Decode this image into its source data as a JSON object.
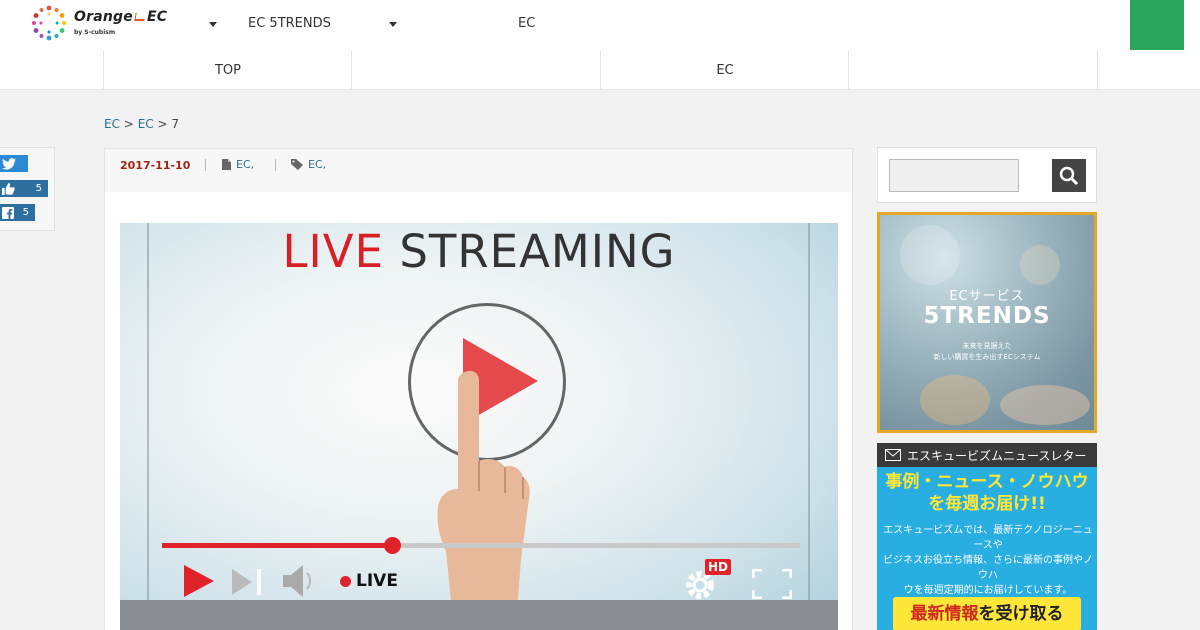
{
  "header": {
    "logo": {
      "name": "Orange",
      "suffix": "EC",
      "sub": "by S-cubism"
    },
    "links": [
      "EC 5TRENDS",
      "EC"
    ],
    "cta_color": "#2aa65a"
  },
  "nav": {
    "items": [
      "TOP",
      "",
      "EC",
      ""
    ]
  },
  "breadcrumb": {
    "items": [
      "EC",
      "EC"
    ],
    "current": "7",
    "separator": ">"
  },
  "share": {
    "twitter_icon": "twitter-bird-icon",
    "like_count": "5",
    "facebook_count": "5"
  },
  "article": {
    "date": "2017-11-10",
    "category": "EC,",
    "tag": "EC,",
    "hero": {
      "title_live": "LIVE",
      "title_rest": " STREAMING",
      "live_label": "LIVE",
      "hd_label": "HD",
      "progress": 0.36,
      "accent": "#e0232b"
    }
  },
  "sidebar": {
    "search": {
      "placeholder": ""
    },
    "banner": {
      "line1": "ECサービス",
      "line2": "5TRENDS",
      "line3": "未来を見据えた\n新しい購買を生み出すECシステム"
    },
    "newsletter": {
      "heading": "エスキュービズムニュースレター",
      "title": "事例・ニュース・ノウハウ\nを毎週お届け!!",
      "body": "エスキュービズムでは、最新テクノロジーニュースや\nビジネスお役立ち情報、さらに最新の事例やノウハ\nウを毎週定期的にお届けしています。\n御社の情報収集にぜひご登録ください。",
      "cta_highlight": "最新情報",
      "cta_rest": "を受け取る"
    }
  }
}
